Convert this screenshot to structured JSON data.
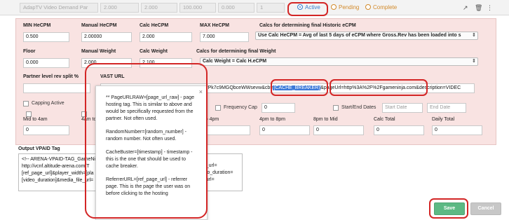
{
  "topbar": {
    "cells": [
      "AdapTV Video Demand Par",
      "2.000",
      "2.000",
      "100.000",
      "0.000",
      "1"
    ],
    "status_options": [
      {
        "label": "Active",
        "selected": true
      },
      {
        "label": "Pending",
        "selected": false
      },
      {
        "label": "Complete",
        "selected": false
      }
    ],
    "icons": [
      "external-link-icon",
      "trash-icon",
      "more-icon"
    ]
  },
  "form": {
    "min_hecpm": {
      "label": "MIN HeCPM",
      "value": "0.500"
    },
    "manual_hecpm": {
      "label": "Manual HeCPM",
      "value": "2.00000"
    },
    "calc_hecpm": {
      "label": "Calc HeCPM",
      "value": "2.000"
    },
    "max_hecpm": {
      "label": "MAX HeCPM",
      "value": "7.000"
    },
    "historic_calc": {
      "label": "Calcs for determining final Historic eCPM",
      "selected": "Use Calc HeCPM = Avg of last 5 days of eCPM where Gross.Rev has been loaded into s"
    },
    "floor": {
      "label": "Floor",
      "value": "0.000"
    },
    "manual_weight": {
      "label": "Manual Weight",
      "value": "2.000"
    },
    "calc_weight": {
      "label": "Calc Weight",
      "value": "2.100"
    },
    "weight_calc": {
      "label": "Calcs for determining final Weight",
      "selected": "Calc Weight = Calc H.eCPM"
    },
    "partner_rev_split": {
      "label": "Partner level rev split %",
      "value": ""
    },
    "vast_url": {
      "label": "VAST URL",
      "prefix": "XfPk7c9MGQbceWWsevw",
      "cb_part": "&cb=",
      "cache_breaker": "[CACHE_BREAKER]",
      "page_url_part": "&pageUrl=http%3A%2F%2Fgameninja.com",
      "suffix": "&description=VIDEC"
    },
    "capping_active": {
      "label": "Capping Active"
    },
    "frequency_cap": {
      "label": "Frequency Cap",
      "value": "0"
    },
    "start_end_dates": {
      "label": "Start/End Dates",
      "start_placeholder": "Start Date",
      "end_placeholder": "End Date"
    },
    "mid_to_4am": {
      "label": "Mid to 4am",
      "value": "0"
    },
    "four_am_to": {
      "label": "4am to 8"
    },
    "to_4pm": {
      "label": "n to 4pm",
      "value": "0"
    },
    "four_pm_to_8pm": {
      "label": "4pm to 8pm",
      "value": "0"
    },
    "eight_pm_to_mid": {
      "label": "8pm to Mid",
      "value": "0"
    },
    "calc_total": {
      "label": "Calc Total",
      "value": "0"
    },
    "daily_total": {
      "label": "Daily Total",
      "value": "0"
    }
  },
  "output_vpaid": {
    "label": "Output VPAID Tag",
    "lines": [
      "<!-- ARENA-VPAID-TAG_GameNin",
      "http://vcnf.altitude-arena.com/T",
      "[ref_page_url]&player_width=[pla",
      "[video_duration]&media_file_url="
    ],
    "right_lines": [
      "ge_url=",
      "ideo_duration=",
      "e_url="
    ]
  },
  "tooltip": {
    "close": "×",
    "paragraphs": [
      "** PageURLRAW=[page_url_raw] - page hosting tag. This is similar to above and would be specifically requested from the partner. Not often used.",
      "RandomNumber=[random_number] - random number. Not often used.",
      "CacheBuster=[timestamp] - timestamp - this is the one that should be used to cache breaker.",
      "ReferrerURL=[ref_page_url] - referrer page. This is the page the user was on before clicking to the hosting"
    ]
  },
  "buttons": {
    "save": "Save",
    "cancel": "Cancel"
  },
  "colors": {
    "panel_bg": "#f9e3e2",
    "highlight": "#d32626",
    "save": "#5cb984",
    "active_radio": "#3a7fd0",
    "pending_radio": "#d28a2a"
  }
}
